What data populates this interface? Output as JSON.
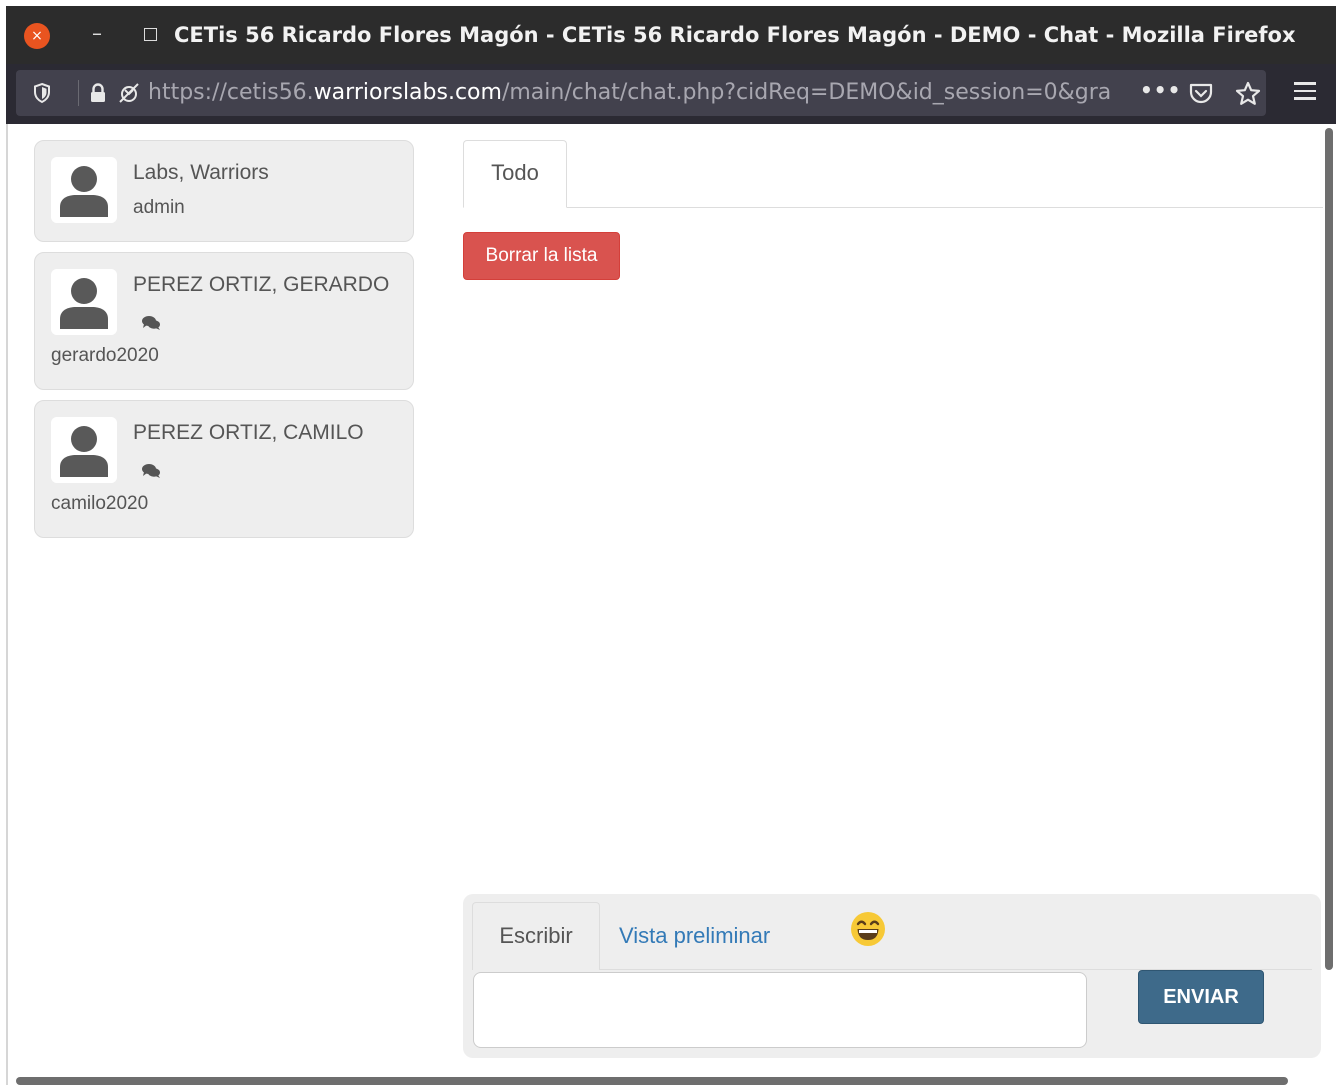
{
  "window": {
    "title": "CETis 56 Ricardo Flores Magón - CETis 56 Ricardo Flores Magón - DEMO - Chat - Mozilla Firefox",
    "close_glyph": "×",
    "minimize_glyph": "–"
  },
  "browser": {
    "url_prefix": "https://cetis56.",
    "url_domain": "warriorslabs.com",
    "url_rest": "/main/chat/chat.php?cidReq=DEMO&id_session=0&gra",
    "more_glyph": "•••"
  },
  "users": [
    {
      "name": "Labs, Warriors",
      "username": "admin"
    },
    {
      "name": "PEREZ ORTIZ, GERARDO",
      "username": "gerardo2020"
    },
    {
      "name": "PEREZ ORTIZ, CAMILO",
      "username": "camilo2020"
    }
  ],
  "chat": {
    "tab_all": "Todo",
    "clear_button": "Borrar la lista"
  },
  "composer": {
    "tab_write": "Escribir",
    "tab_preview": "Vista preliminar",
    "message_value": "",
    "send_button": "ENVIAR"
  },
  "colors": {
    "accent_close": "#e95420",
    "danger": "#d9534f",
    "send": "#3e6a8a",
    "link": "#337ab7"
  }
}
